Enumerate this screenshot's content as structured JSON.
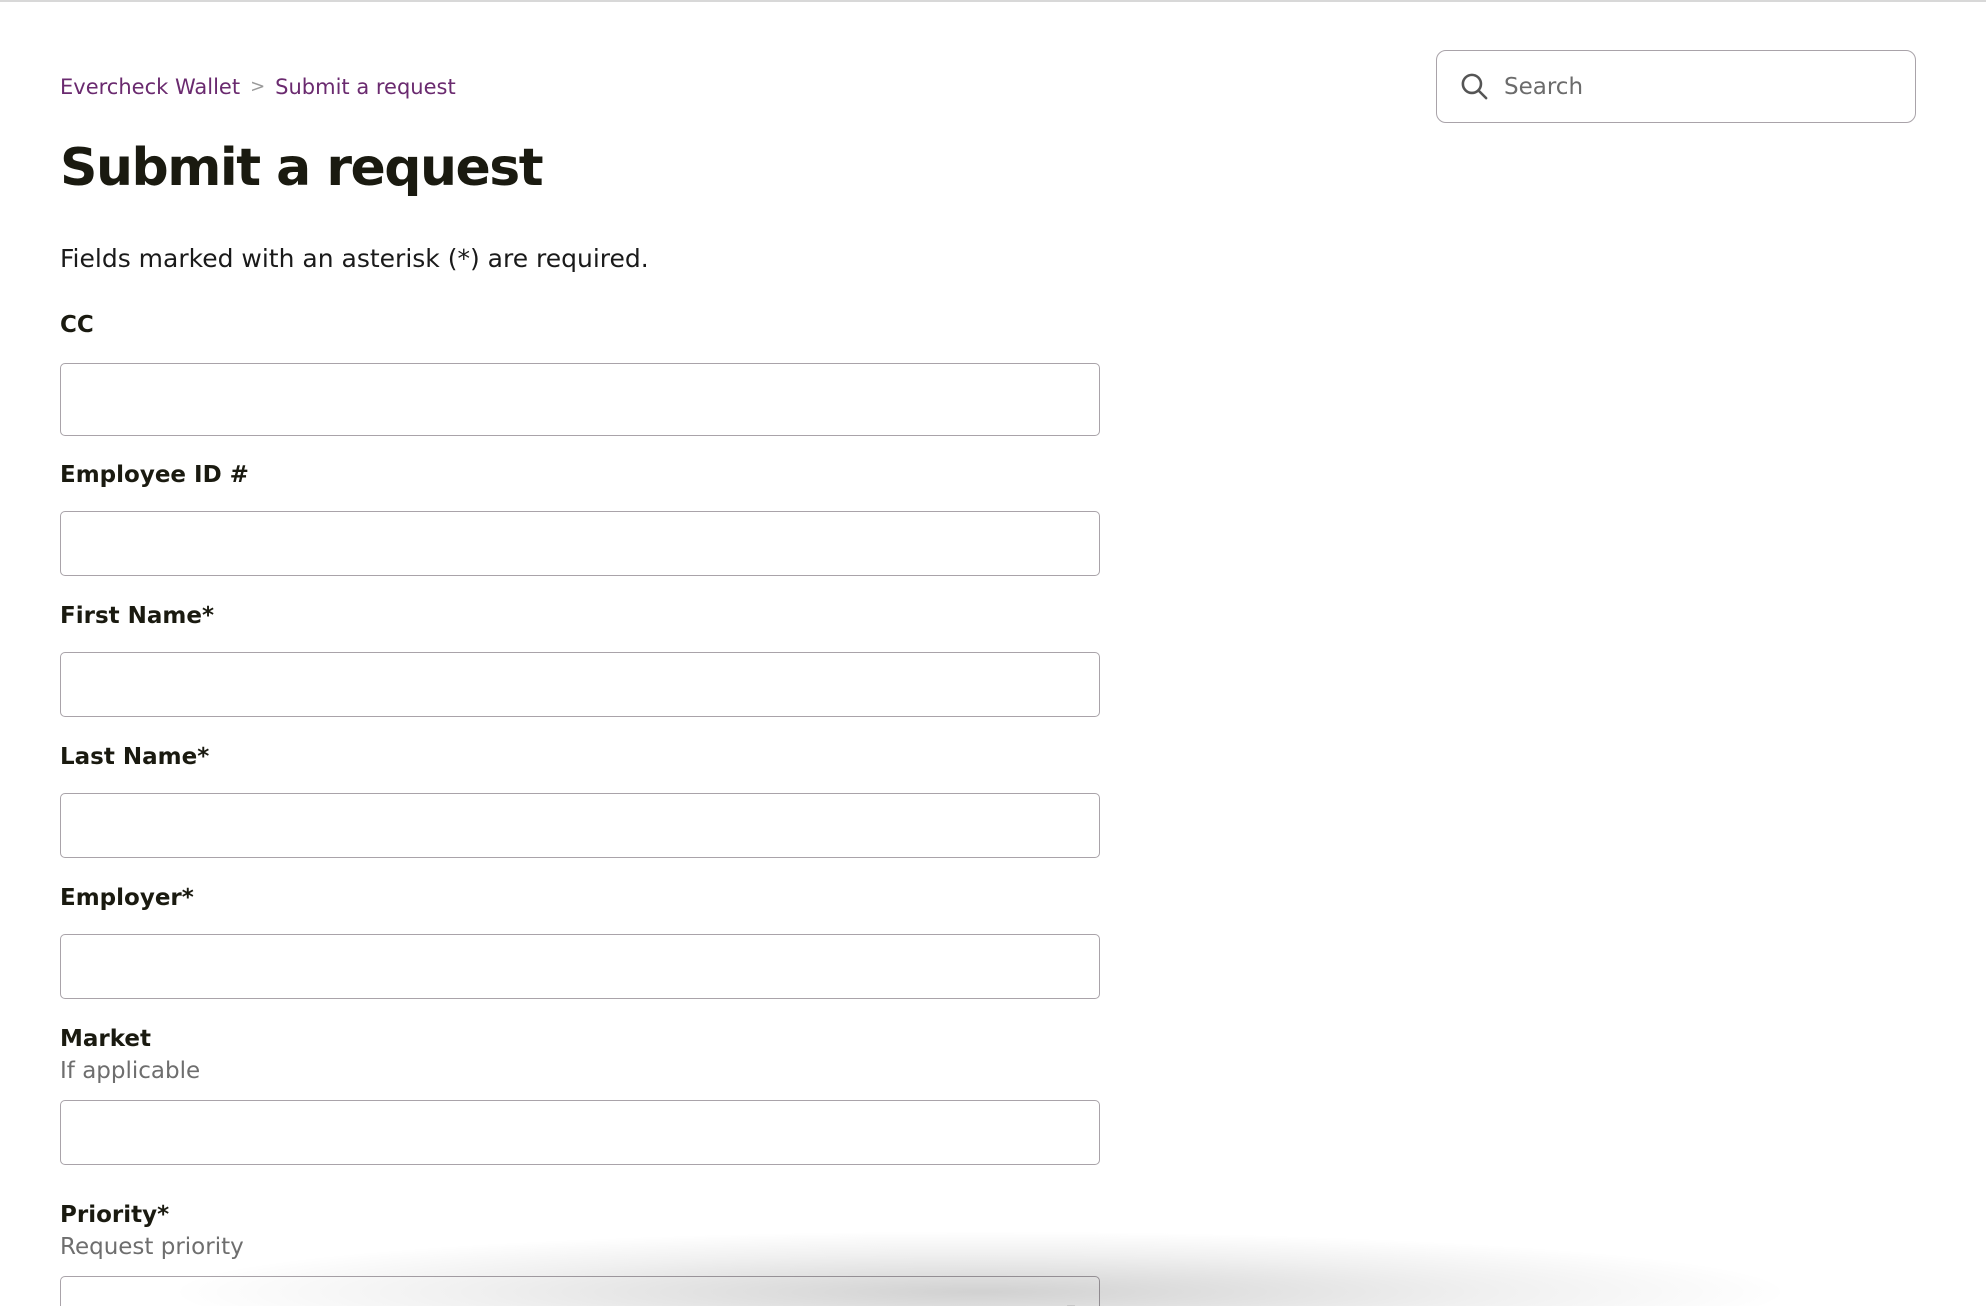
{
  "breadcrumb": {
    "items": [
      "Evercheck Wallet",
      "Submit a request"
    ],
    "separator": ">"
  },
  "search": {
    "placeholder": "Search"
  },
  "page": {
    "title": "Submit a request",
    "required_note": "Fields marked with an asterisk (*) are required."
  },
  "form": {
    "cc": {
      "label": "CC",
      "value": ""
    },
    "employee_id": {
      "label": "Employee ID #",
      "value": ""
    },
    "first_name": {
      "label": "First Name*",
      "value": ""
    },
    "last_name": {
      "label": "Last Name*",
      "value": ""
    },
    "employer": {
      "label": "Employer*",
      "value": ""
    },
    "market": {
      "label": "Market",
      "hint": "If applicable",
      "value": ""
    },
    "priority": {
      "label": "Priority*",
      "hint": "Request priority",
      "value": ""
    }
  },
  "colors": {
    "link": "#6a2a6f",
    "border": "#a9a3a9",
    "hint": "#6e6e6e",
    "heading": "#1a1a10"
  }
}
